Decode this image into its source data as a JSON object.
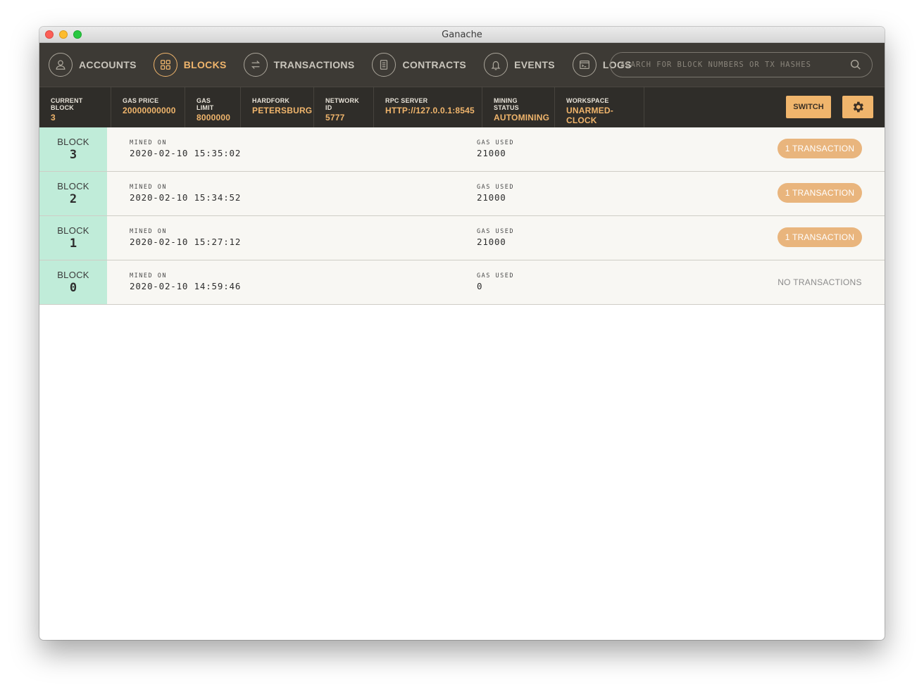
{
  "window": {
    "title": "Ganache"
  },
  "nav": {
    "items": [
      {
        "label": "ACCOUNTS"
      },
      {
        "label": "BLOCKS"
      },
      {
        "label": "TRANSACTIONS"
      },
      {
        "label": "CONTRACTS"
      },
      {
        "label": "EVENTS"
      },
      {
        "label": "LOGS"
      }
    ],
    "active": "BLOCKS",
    "search_placeholder": "SEARCH FOR BLOCK NUMBERS OR TX HASHES"
  },
  "status": {
    "current_block": {
      "label": "CURRENT BLOCK",
      "value": "3"
    },
    "gas_price": {
      "label": "GAS PRICE",
      "value": "20000000000"
    },
    "gas_limit": {
      "label": "GAS LIMIT",
      "value": "8000000"
    },
    "hardfork": {
      "label": "HARDFORK",
      "value": "PETERSBURG"
    },
    "network_id": {
      "label": "NETWORK ID",
      "value": "5777"
    },
    "rpc_server": {
      "label": "RPC SERVER",
      "value": "HTTP://127.0.0.1:8545"
    },
    "mining_status": {
      "label": "MINING STATUS",
      "value": "AUTOMINING"
    },
    "workspace": {
      "label": "WORKSPACE",
      "value": "UNARMED-CLOCK"
    },
    "switch_label": "SWITCH"
  },
  "blocks": [
    {
      "block_label": "BLOCK",
      "number": "3",
      "mined_label": "MINED ON",
      "mined_on": "2020-02-10 15:35:02",
      "gas_label": "GAS USED",
      "gas_used": "21000",
      "tx": "1 TRANSACTION"
    },
    {
      "block_label": "BLOCK",
      "number": "2",
      "mined_label": "MINED ON",
      "mined_on": "2020-02-10 15:34:52",
      "gas_label": "GAS USED",
      "gas_used": "21000",
      "tx": "1 TRANSACTION"
    },
    {
      "block_label": "BLOCK",
      "number": "1",
      "mined_label": "MINED ON",
      "mined_on": "2020-02-10 15:27:12",
      "gas_label": "GAS USED",
      "gas_used": "21000",
      "tx": "1 TRANSACTION"
    },
    {
      "block_label": "BLOCK",
      "number": "0",
      "mined_label": "MINED ON",
      "mined_on": "2020-02-10 14:59:46",
      "gas_label": "GAS USED",
      "gas_used": "0",
      "tx": "NO TRANSACTIONS"
    }
  ],
  "colors": {
    "accent": "#f0b56c",
    "block_bg": "#c0ecd9",
    "nav_bg": "#3d3a35"
  }
}
